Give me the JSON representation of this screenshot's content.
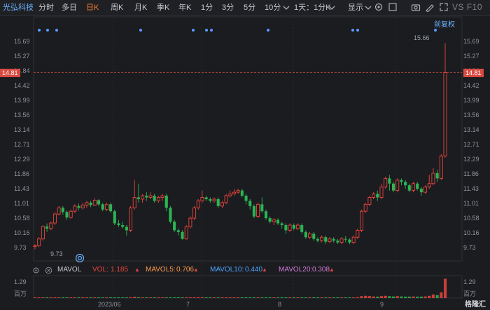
{
  "toolbar": {
    "stock_name": "光弘科技",
    "periods": [
      "分时",
      "多日",
      "日K",
      "周K",
      "月K",
      "季K",
      "年K",
      "1分",
      "3分",
      "5分",
      "10分"
    ],
    "active_period": "日K",
    "combo": "1天：1分K",
    "display": "显示",
    "vs_f10": "VS F10"
  },
  "price_panel": {
    "adjust_label": "前复权",
    "y_ticks": [
      "15.69",
      "15.27",
      "14.84",
      "14.42",
      "13.99",
      "13.56",
      "13.14",
      "12.71",
      "12.29",
      "11.86",
      "11.43",
      "11.01",
      "10.58",
      "10.16",
      "9.73"
    ],
    "current_price": "14.81",
    "high_label": "15.66",
    "low_label": "9.73"
  },
  "volume_panel": {
    "label": "MAVOL",
    "vol_label": "VOL:",
    "vol_value": "1.185",
    "ma5_label": "MAVOL5:",
    "ma5_value": "0.706",
    "ma10_label": "MAVOL10:",
    "ma10_value": "0.440",
    "ma20_label": "MAVOL20:",
    "ma20_value": "0.308",
    "y_top": "1.29",
    "y_unit": "百万"
  },
  "x_axis": [
    "2023/06",
    "7",
    "8",
    "9"
  ],
  "logo": "格隆汇",
  "colors": {
    "up": "#e8453c",
    "down": "#2bb552",
    "accent": "#ff7a2f",
    "link": "#6cb2ff"
  },
  "chart_data": {
    "type": "candlestick",
    "price_ylim": [
      9.73,
      15.69
    ],
    "candles": [
      [
        9.78,
        9.8,
        9.7,
        9.85
      ],
      [
        9.8,
        10.0,
        9.76,
        10.05
      ],
      [
        10.0,
        10.36,
        9.95,
        10.4
      ],
      [
        10.36,
        10.3,
        10.2,
        10.45
      ],
      [
        10.3,
        10.46,
        10.25,
        10.5
      ],
      [
        10.46,
        10.72,
        10.4,
        10.78
      ],
      [
        10.72,
        10.9,
        10.68,
        10.95
      ],
      [
        10.9,
        10.78,
        10.7,
        10.95
      ],
      [
        10.78,
        10.62,
        10.55,
        10.82
      ],
      [
        10.62,
        10.8,
        10.58,
        10.85
      ],
      [
        10.8,
        10.95,
        10.75,
        11.0
      ],
      [
        10.95,
        10.9,
        10.82,
        11.02
      ],
      [
        10.9,
        10.98,
        10.85,
        11.05
      ],
      [
        10.98,
        11.05,
        10.9,
        11.1
      ],
      [
        11.05,
        10.98,
        10.92,
        11.1
      ],
      [
        10.98,
        11.12,
        10.95,
        11.18
      ],
      [
        11.12,
        11.0,
        10.95,
        11.15
      ],
      [
        11.0,
        10.85,
        10.8,
        11.05
      ],
      [
        10.85,
        11.0,
        10.8,
        11.05
      ],
      [
        11.0,
        10.8,
        10.75,
        11.05
      ],
      [
        10.8,
        10.45,
        10.4,
        10.85
      ],
      [
        10.45,
        10.4,
        10.35,
        10.55
      ],
      [
        10.4,
        10.35,
        10.3,
        10.5
      ],
      [
        10.35,
        10.25,
        10.1,
        10.4
      ],
      [
        10.25,
        10.9,
        10.2,
        10.95
      ],
      [
        10.9,
        11.2,
        10.85,
        11.7
      ],
      [
        11.2,
        11.15,
        11.05,
        11.6
      ],
      [
        11.15,
        11.25,
        11.05,
        11.3
      ],
      [
        11.25,
        11.2,
        11.1,
        11.35
      ],
      [
        11.2,
        11.25,
        11.15,
        11.35
      ],
      [
        11.25,
        11.1,
        11.05,
        11.3
      ],
      [
        11.1,
        11.2,
        11.05,
        11.25
      ],
      [
        11.2,
        11.25,
        11.1,
        11.3
      ],
      [
        11.25,
        10.9,
        10.8,
        11.3
      ],
      [
        10.9,
        10.5,
        10.45,
        10.95
      ],
      [
        10.5,
        10.25,
        10.2,
        10.55
      ],
      [
        10.25,
        10.2,
        10.1,
        10.3
      ],
      [
        10.2,
        10.0,
        9.98,
        10.25
      ],
      [
        10.0,
        10.35,
        9.98,
        10.4
      ],
      [
        10.35,
        10.6,
        10.3,
        10.65
      ],
      [
        10.6,
        10.9,
        10.55,
        10.95
      ],
      [
        10.9,
        11.1,
        10.85,
        11.15
      ],
      [
        11.1,
        11.2,
        11.05,
        11.4
      ],
      [
        11.2,
        11.15,
        11.1,
        11.25
      ],
      [
        11.15,
        11.1,
        11.05,
        11.2
      ],
      [
        11.1,
        11.15,
        11.05,
        11.2
      ],
      [
        11.15,
        10.95,
        10.9,
        11.2
      ],
      [
        10.95,
        11.05,
        10.9,
        11.1
      ],
      [
        11.05,
        11.25,
        11.0,
        11.3
      ],
      [
        11.25,
        11.3,
        11.2,
        11.4
      ],
      [
        11.3,
        11.35,
        11.25,
        11.45
      ],
      [
        11.35,
        11.4,
        11.3,
        11.45
      ],
      [
        11.4,
        11.25,
        11.2,
        11.45
      ],
      [
        11.25,
        11.1,
        11.0,
        11.3
      ],
      [
        11.1,
        10.95,
        10.85,
        11.15
      ],
      [
        10.95,
        10.65,
        10.6,
        11.0
      ],
      [
        10.65,
        11.0,
        10.6,
        11.05
      ],
      [
        11.0,
        10.8,
        10.75,
        11.2
      ],
      [
        10.8,
        10.6,
        10.55,
        10.85
      ],
      [
        10.6,
        10.5,
        10.45,
        10.65
      ],
      [
        10.5,
        10.55,
        10.4,
        10.6
      ],
      [
        10.55,
        10.45,
        10.4,
        10.6
      ],
      [
        10.45,
        10.4,
        10.3,
        10.5
      ],
      [
        10.4,
        10.25,
        10.15,
        10.45
      ],
      [
        10.25,
        10.4,
        10.2,
        10.45
      ],
      [
        10.4,
        10.3,
        10.25,
        10.45
      ],
      [
        10.3,
        10.4,
        10.25,
        10.45
      ],
      [
        10.4,
        10.2,
        10.15,
        10.45
      ],
      [
        10.2,
        10.05,
        10.0,
        10.25
      ],
      [
        10.05,
        10.15,
        10.0,
        10.2
      ],
      [
        10.15,
        10.0,
        9.95,
        10.2
      ],
      [
        10.0,
        9.95,
        9.9,
        10.05
      ],
      [
        9.95,
        10.05,
        9.9,
        10.1
      ],
      [
        10.05,
        9.92,
        9.85,
        10.1
      ],
      [
        9.92,
        10.0,
        9.88,
        10.05
      ],
      [
        10.0,
        9.95,
        9.9,
        10.05
      ],
      [
        9.95,
        9.9,
        9.85,
        10.0
      ],
      [
        9.9,
        10.0,
        9.85,
        10.05
      ],
      [
        10.0,
        9.98,
        9.9,
        10.08
      ],
      [
        9.98,
        9.9,
        9.85,
        10.02
      ],
      [
        9.9,
        10.05,
        9.85,
        10.1
      ],
      [
        10.05,
        10.25,
        10.0,
        10.3
      ],
      [
        10.25,
        10.8,
        10.2,
        10.85
      ],
      [
        10.8,
        11.0,
        10.75,
        11.05
      ],
      [
        11.0,
        11.2,
        10.95,
        11.25
      ],
      [
        11.2,
        11.3,
        11.15,
        11.35
      ],
      [
        11.3,
        11.2,
        11.1,
        11.4
      ],
      [
        11.2,
        11.5,
        11.15,
        11.6
      ],
      [
        11.5,
        11.75,
        11.45,
        11.8
      ],
      [
        11.75,
        11.6,
        11.4,
        11.85
      ],
      [
        11.6,
        11.4,
        11.35,
        11.65
      ],
      [
        11.4,
        11.7,
        11.35,
        11.75
      ],
      [
        11.7,
        11.65,
        11.55,
        11.75
      ],
      [
        11.65,
        11.55,
        11.45,
        11.7
      ],
      [
        11.55,
        11.4,
        11.35,
        11.6
      ],
      [
        11.4,
        11.6,
        11.35,
        11.65
      ],
      [
        11.6,
        11.45,
        11.4,
        11.65
      ],
      [
        11.45,
        11.35,
        11.25,
        11.5
      ],
      [
        11.35,
        11.5,
        11.3,
        11.55
      ],
      [
        11.5,
        11.6,
        11.45,
        11.85
      ],
      [
        11.6,
        11.9,
        11.55,
        12.05
      ],
      [
        11.9,
        11.75,
        11.65,
        12.0
      ],
      [
        11.75,
        12.4,
        11.7,
        12.45
      ],
      [
        12.4,
        14.81,
        12.35,
        15.66
      ]
    ],
    "volumes": [
      0.02,
      0.03,
      0.04,
      0.03,
      0.03,
      0.04,
      0.04,
      0.03,
      0.03,
      0.03,
      0.03,
      0.03,
      0.03,
      0.03,
      0.03,
      0.03,
      0.03,
      0.03,
      0.03,
      0.03,
      0.04,
      0.03,
      0.03,
      0.03,
      0.05,
      0.08,
      0.05,
      0.04,
      0.03,
      0.03,
      0.03,
      0.03,
      0.03,
      0.04,
      0.04,
      0.04,
      0.03,
      0.03,
      0.04,
      0.04,
      0.05,
      0.05,
      0.05,
      0.04,
      0.03,
      0.03,
      0.03,
      0.03,
      0.04,
      0.04,
      0.04,
      0.03,
      0.03,
      0.03,
      0.04,
      0.04,
      0.04,
      0.03,
      0.03,
      0.03,
      0.03,
      0.03,
      0.03,
      0.03,
      0.03,
      0.03,
      0.03,
      0.03,
      0.03,
      0.03,
      0.03,
      0.03,
      0.03,
      0.03,
      0.03,
      0.03,
      0.03,
      0.03,
      0.03,
      0.03,
      0.04,
      0.05,
      0.12,
      0.14,
      0.12,
      0.1,
      0.09,
      0.12,
      0.14,
      0.12,
      0.1,
      0.12,
      0.1,
      0.09,
      0.09,
      0.1,
      0.09,
      0.09,
      0.1,
      0.14,
      0.22,
      0.18,
      0.35,
      1.185
    ],
    "volume_ylim": [
      0,
      1.29
    ]
  }
}
